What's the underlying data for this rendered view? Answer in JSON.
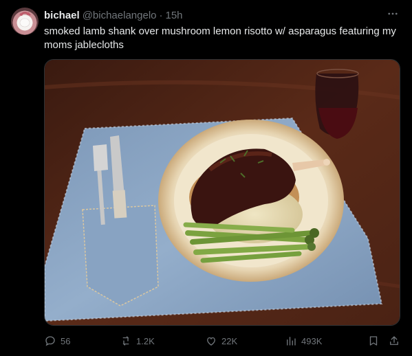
{
  "author": {
    "display_name": "bichael",
    "handle": "@bichaelangelo",
    "separator": "·",
    "time": "15h"
  },
  "post": {
    "text": "smoked lamb shank over mushroom lemon risotto w/ asparagus featuring my moms jablecloths"
  },
  "icons": {
    "more": "more-dots-icon",
    "reply": "reply-icon",
    "repost": "repost-icon",
    "like": "heart-icon",
    "views": "views-bar-chart-icon",
    "bookmark": "bookmark-icon",
    "share": "share-icon"
  },
  "metrics": {
    "replies": "56",
    "reposts": "1.2K",
    "likes": "22K",
    "views": "493K"
  },
  "colors": {
    "background": "#000000",
    "text_primary": "#e7e9ea",
    "text_secondary": "#71767b"
  }
}
